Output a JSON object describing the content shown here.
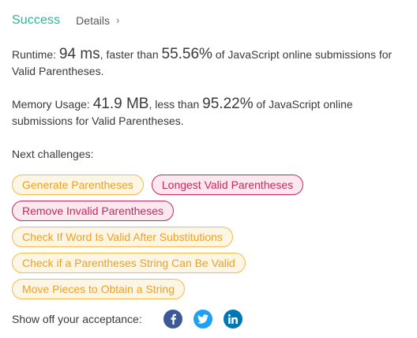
{
  "header": {
    "status": "Success",
    "details_label": "Details",
    "status_color": "#2db59a"
  },
  "runtime": {
    "label": "Runtime: ",
    "value": "94 ms",
    "mid_text": ", faster than ",
    "percent": "55.56%",
    "tail_text": " of JavaScript online submissions for Valid Parentheses."
  },
  "memory": {
    "label": "Memory Usage: ",
    "value": "41.9 MB",
    "mid_text": ", less than ",
    "percent": "95.22%",
    "tail_text": " of JavaScript online submissions for Valid Parentheses."
  },
  "next": {
    "label": "Next challenges:",
    "challenges": [
      {
        "title": "Generate Parentheses",
        "difficulty": "medium"
      },
      {
        "title": "Longest Valid Parentheses",
        "difficulty": "hard"
      },
      {
        "title": "Remove Invalid Parentheses",
        "difficulty": "hard"
      },
      {
        "title": "Check If Word Is Valid After Substitutions",
        "difficulty": "medium"
      },
      {
        "title": "Check if a Parentheses String Can Be Valid",
        "difficulty": "medium"
      },
      {
        "title": "Move Pieces to Obtain a String",
        "difficulty": "medium"
      }
    ]
  },
  "share": {
    "label": "Show off your acceptance:",
    "icons": [
      "facebook-icon",
      "twitter-icon",
      "linkedin-icon"
    ],
    "colors": {
      "facebook": "#3b5998",
      "twitter": "#1da1f2",
      "linkedin": "#0077b5"
    }
  },
  "colors": {
    "medium_text": "#f0a020",
    "medium_border": "#f5b94a",
    "medium_bg": "#fef6e5",
    "hard_text": "#c8285f",
    "hard_bg": "#fde8ef"
  }
}
